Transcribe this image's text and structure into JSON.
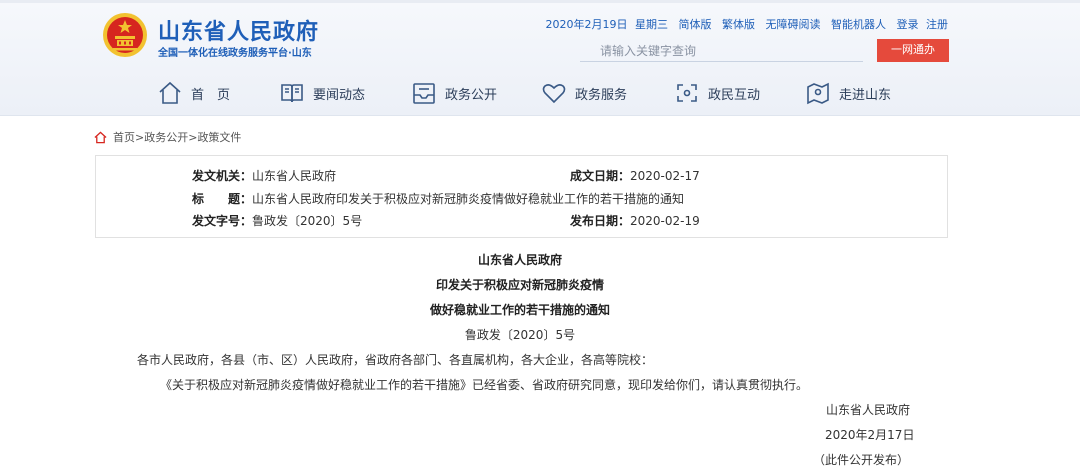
{
  "site": {
    "title": "山东省人民政府",
    "subtitle": "全国一体化在线政务服务平台·山东"
  },
  "toplinks": {
    "date": "2020年2月19日",
    "weekday": "星期三",
    "items": [
      "简体版",
      "繁体版",
      "无障碍阅读",
      "智能机器人",
      "登录",
      "注册"
    ]
  },
  "search": {
    "placeholder": "请输入关键字查询",
    "button": "一网通办"
  },
  "nav": [
    {
      "label": "首　页",
      "icon": "home-icon"
    },
    {
      "label": "要闻动态",
      "icon": "book-icon"
    },
    {
      "label": "政务公开",
      "icon": "inbox-icon"
    },
    {
      "label": "政务服务",
      "icon": "heart-icon"
    },
    {
      "label": "政民互动",
      "icon": "interaction-icon"
    },
    {
      "label": "走进山东",
      "icon": "map-pin-icon"
    }
  ],
  "breadcrumb": [
    "首页",
    "政务公开",
    "政策文件"
  ],
  "meta": {
    "issuer_label": "发文机关：",
    "issuer": "山东省人民政府",
    "date_made_label": "成文日期：",
    "date_made": "2020-02-17",
    "title_label": "标　　题：",
    "title": "山东省人民政府印发关于积极应对新冠肺炎疫情做好稳就业工作的若干措施的通知",
    "doc_no_label": "发文字号：",
    "doc_no": "鲁政发〔2020〕5号",
    "pub_date_label": "发布日期：",
    "pub_date": "2020-02-19"
  },
  "document": {
    "heading1": "山东省人民政府",
    "heading2": "印发关于积极应对新冠肺炎疫情",
    "heading3": "做好稳就业工作的若干措施的通知",
    "doc_no": "鲁政发〔2020〕5号",
    "recipients": "各市人民政府，各县（市、区）人民政府，省政府各部门、各直属机构，各大企业，各高等院校：",
    "body": "《关于积极应对新冠肺炎疫情做好稳就业工作的若干措施》已经省委、省政府研究同意，现印发给你们，请认真贯彻执行。",
    "signature": "山东省人民政府",
    "sign_date": "2020年2月17日",
    "note": "（此件公开发布）"
  },
  "colors": {
    "brand_blue": "#1f5fb8",
    "button_red": "#e54a3c",
    "emblem_red": "#d6261f",
    "emblem_gold": "#f2c230"
  }
}
